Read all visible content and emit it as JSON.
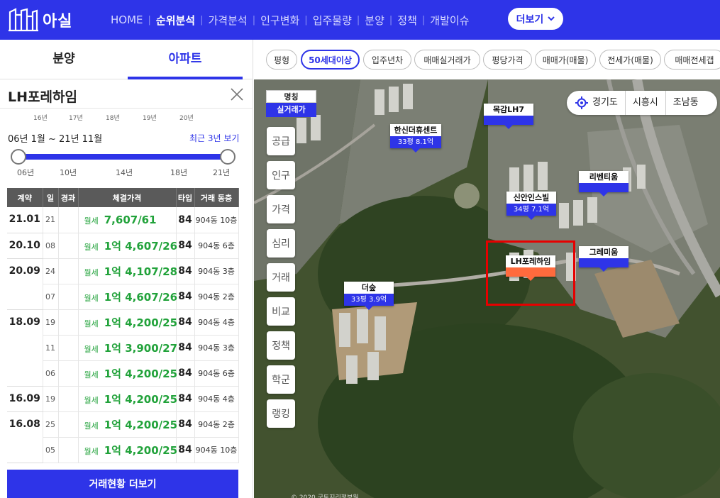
{
  "header": {
    "logo_text": "아실",
    "nav": [
      "HOME",
      "순위분석",
      "가격분석",
      "인구변화",
      "입주물량",
      "분양",
      "정책",
      "개발이슈"
    ],
    "active_nav": "순위분석",
    "more_label": "더보기"
  },
  "left": {
    "tabs": [
      "분양",
      "아파트"
    ],
    "active_tab": "아파트",
    "apt_name": "LH포레하임",
    "years_top": [
      "16년",
      "17년",
      "18년",
      "19년",
      "20년"
    ],
    "range_text": "06년 1월 ~ 21년 11월",
    "recent_link": "최근 3년 보기",
    "slider_labels": [
      "06년",
      "10년",
      "14년",
      "18년",
      "21년"
    ],
    "table_headers": [
      "계약",
      "일",
      "경과",
      "체결가격",
      "타입",
      "거래 동층"
    ],
    "rows": [
      {
        "date": "21.01",
        "rowspan": 1,
        "day": "21",
        "ptype": "월세",
        "price": "7,607/61",
        "type": "84",
        "floor": "904동 10층"
      },
      {
        "date": "20.10",
        "rowspan": 1,
        "day": "08",
        "ptype": "월세",
        "price": "1억 4,607/26",
        "type": "84",
        "floor": "904동 6층"
      },
      {
        "date": "20.09",
        "rowspan": 2,
        "day": "24",
        "ptype": "월세",
        "price": "1억 4,107/28",
        "type": "84",
        "floor": "904동 3층"
      },
      {
        "date": "",
        "rowspan": 0,
        "day": "07",
        "ptype": "월세",
        "price": "1억 4,607/26",
        "type": "84",
        "floor": "904동 2층"
      },
      {
        "date": "18.09",
        "rowspan": 3,
        "day": "19",
        "ptype": "월세",
        "price": "1억 4,200/25",
        "type": "84",
        "floor": "904동 4층"
      },
      {
        "date": "",
        "rowspan": 0,
        "day": "11",
        "ptype": "월세",
        "price": "1억 3,900/27",
        "type": "84",
        "floor": "904동 3층"
      },
      {
        "date": "",
        "rowspan": 0,
        "day": "06",
        "ptype": "월세",
        "price": "1억 4,200/25",
        "type": "84",
        "floor": "904동 6층"
      },
      {
        "date": "16.09",
        "rowspan": 1,
        "day": "19",
        "ptype": "월세",
        "price": "1억 4,200/25",
        "type": "84",
        "floor": "904동 4층"
      },
      {
        "date": "16.08",
        "rowspan": 2,
        "day": "25",
        "ptype": "월세",
        "price": "1억 4,200/25",
        "type": "84",
        "floor": "904동 2층"
      },
      {
        "date": "",
        "rowspan": 0,
        "day": "05",
        "ptype": "월세",
        "price": "1억 4,200/25",
        "type": "84",
        "floor": "904동 10층"
      }
    ],
    "more_tx_label": "거래현황 더보기"
  },
  "map": {
    "chips": [
      "평형",
      "50세대이상",
      "입주년차",
      "매매실거래가",
      "평당가격",
      "매매가(매물)",
      "전세가(매물)",
      "매매전세갭"
    ],
    "active_chip": "50세대이상",
    "legend_name": "명칭",
    "legend_price": "실거래가",
    "side_buttons": [
      "공급",
      "인구",
      "가격",
      "심리",
      "거래",
      "비교",
      "정책",
      "학군",
      "랭킹"
    ],
    "location": [
      "경기도",
      "시흥시",
      "조남동"
    ],
    "markers": [
      {
        "name": "목감LH7",
        "price": ""
      },
      {
        "name": "한신더휴센트",
        "price": "33평 8.1억"
      },
      {
        "name": "리벤티움",
        "price": ""
      },
      {
        "name": "신안인스빌",
        "price": "34평 7.1억"
      },
      {
        "name": "그레미움",
        "price": ""
      },
      {
        "name": "LH포레하임",
        "price": ""
      },
      {
        "name": "더숲",
        "price": "33평 3.9억"
      }
    ],
    "copyright": "© 2020 국토지리정보원"
  },
  "colors": {
    "brand": "#2e34e8",
    "price_green": "#21a23a",
    "selected_marker": "#ff6a3d",
    "highlight": "#e60000"
  }
}
